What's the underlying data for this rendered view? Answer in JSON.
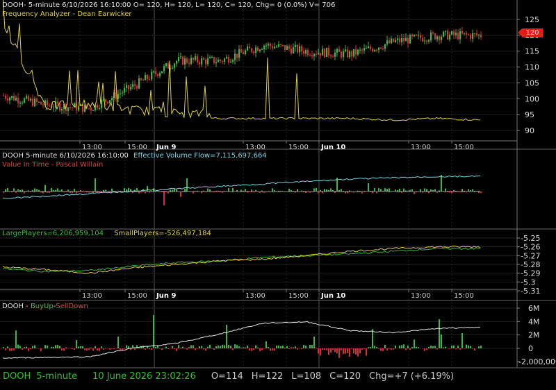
{
  "colors": {
    "bg": "#000000",
    "up": "#3fb83f",
    "down": "#d83030",
    "yellow": "#e0d040",
    "white": "#e8e8e8",
    "cyan": "#7fd7e8",
    "grid": "#2a2a2a"
  },
  "panels": [
    {
      "title": "DOOH- 5-minute 6/10/2026 16:10:00 O= 120, H= 120, L= 120, C= 120, Chg= 0 (0.0%) V= 706",
      "subtitle": "Frequency Analyzer - Dean Earwicker",
      "yticks": [
        "125",
        "120",
        "115",
        "110",
        "105",
        "100",
        "95",
        "90"
      ],
      "price_tag": "120"
    },
    {
      "title": "DOOH 5-minute  6/10/2026 16:10:00",
      "indicator": "Effective Volume Flow=7,115,697,664",
      "subtitle": "Value In Time - Pascal Willain"
    },
    {
      "large_label": "LargePlayers=6,206,959,104",
      "small_label": "SmallPlayers=-526,497,184",
      "yticks": [
        "-5.25",
        "-5.26",
        "-5.27",
        "-5.28",
        "-5.29",
        "-5.3",
        "-5.31"
      ]
    },
    {
      "title": "DOOH - ",
      "buy": "BuyUp",
      "dash": "-",
      "sell": "SellDown",
      "yticks": [
        "6M",
        "4M",
        "2M",
        "0",
        "-2,000,000"
      ]
    }
  ],
  "time_axis": [
    "13:00",
    "15:00",
    "Jun 9",
    "13:00",
    "15:00",
    "Jun 10",
    "13:00",
    "15:00"
  ],
  "status_bar": {
    "symbol": "DOOH",
    "interval": "5-minute",
    "datetime": "10 June 2026 23:02:26",
    "o": "O=114",
    "h": "H=122",
    "l": "L=108",
    "c": "C=120",
    "chg": "Chg=+7 (+6.19%)"
  },
  "chart_data": [
    {
      "type": "candlestick",
      "ylim": [
        88,
        127
      ],
      "x": [
        "Jun 8 13:00",
        "Jun 8 15:00",
        "Jun 9",
        "Jun 9 13:00",
        "Jun 9 15:00",
        "Jun 10",
        "Jun 10 13:00",
        "Jun 10 15:00"
      ],
      "close": [
        101,
        98,
        97,
        104,
        112,
        112,
        117,
        115,
        114,
        118,
        120,
        120
      ],
      "frequency_analyzer": [
        122,
        96,
        97,
        95,
        94,
        93.5,
        93.5,
        93.5,
        93.5,
        93,
        93.5,
        93
      ]
    },
    {
      "type": "bar",
      "series": [
        {
          "name": "Effective Volume Flow",
          "values": [
            -2,
            -1,
            0,
            1,
            2,
            3,
            4,
            5,
            6,
            6.5,
            7,
            7.1
          ]
        }
      ]
    },
    {
      "type": "line",
      "ylim": [
        -5.31,
        -5.25
      ],
      "series": [
        {
          "name": "LargePlayers",
          "values": [
            -5.285,
            -5.288,
            -5.287,
            -5.282,
            -5.278,
            -5.276,
            -5.272,
            -5.27,
            -5.268,
            -5.265,
            -5.262,
            -5.262
          ]
        },
        {
          "name": "SmallPlayers",
          "values": [
            -5.283,
            -5.286,
            -5.29,
            -5.284,
            -5.28,
            -5.276,
            -5.274,
            -5.27,
            -5.265,
            -5.262,
            -5.26,
            -5.26
          ]
        }
      ]
    },
    {
      "type": "bar",
      "ylim": [
        -2000000,
        6000000
      ],
      "series": [
        {
          "name": "BuyUp",
          "values": [
            0,
            0.1,
            0.2,
            1.5,
            2.2,
            3.6,
            5.2,
            5.4,
            4.1,
            3.8,
            4.4,
            4.6
          ]
        }
      ]
    }
  ]
}
